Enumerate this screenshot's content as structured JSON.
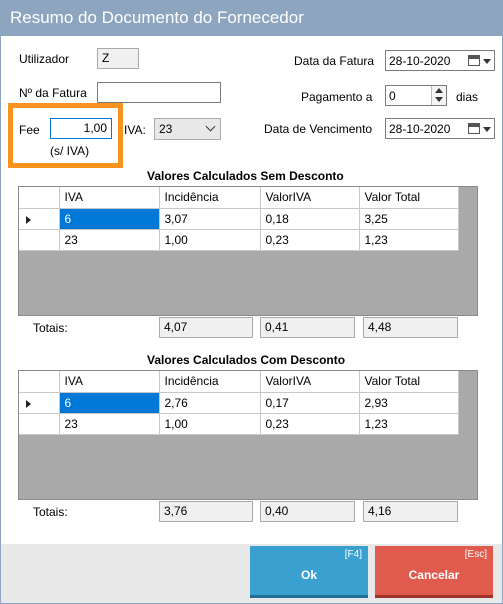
{
  "window": {
    "title": "Resumo do Documento do Fornecedor"
  },
  "form": {
    "utilizador_label": "Utilizador",
    "utilizador_value": "Z",
    "fatura_label": "Nº da Fatura",
    "fatura_value": "",
    "fee_label": "Fee",
    "fee_value": "1,00",
    "fee_note": "(s/ IVA)",
    "iva_label": "IVA:",
    "iva_value": "23",
    "data_fatura_label": "Data da Fatura",
    "data_fatura_value": "28-10-2020",
    "pagamento_label": "Pagamento a",
    "pagamento_value": "0",
    "dias_label": "dias",
    "data_vencimento_label": "Data de Vencimento",
    "data_vencimento_value": "28-10-2020"
  },
  "sem_desconto": {
    "title": "Valores Calculados Sem Desconto",
    "columns": [
      "IVA",
      "Incidência",
      "ValorIVA",
      "Valor Total"
    ],
    "rows": [
      [
        "6",
        "3,07",
        "0,18",
        "3,25"
      ],
      [
        "23",
        "1,00",
        "0,23",
        "1,23"
      ]
    ],
    "totais_label": "Totais:",
    "totais": [
      "4,07",
      "0,41",
      "4,48"
    ]
  },
  "com_desconto": {
    "title": "Valores Calculados Com Desconto",
    "columns": [
      "IVA",
      "Incidência",
      "ValorIVA",
      "Valor Total"
    ],
    "rows": [
      [
        "6",
        "2,76",
        "0,17",
        "2,93"
      ],
      [
        "23",
        "1,00",
        "0,23",
        "1,23"
      ]
    ],
    "totais_label": "Totais:",
    "totais": [
      "3,76",
      "0,40",
      "4,16"
    ]
  },
  "actions": {
    "ok_label": "Ok",
    "ok_key": "[F4]",
    "cancel_label": "Cancelar",
    "cancel_key": "[Esc]"
  },
  "colors": {
    "titlebar": "#8ea5c0",
    "highlight": "#f7931e",
    "selected_cell": "#0078d7",
    "ok_button": "#3aa0d0",
    "cancel_button": "#e05a4d"
  }
}
